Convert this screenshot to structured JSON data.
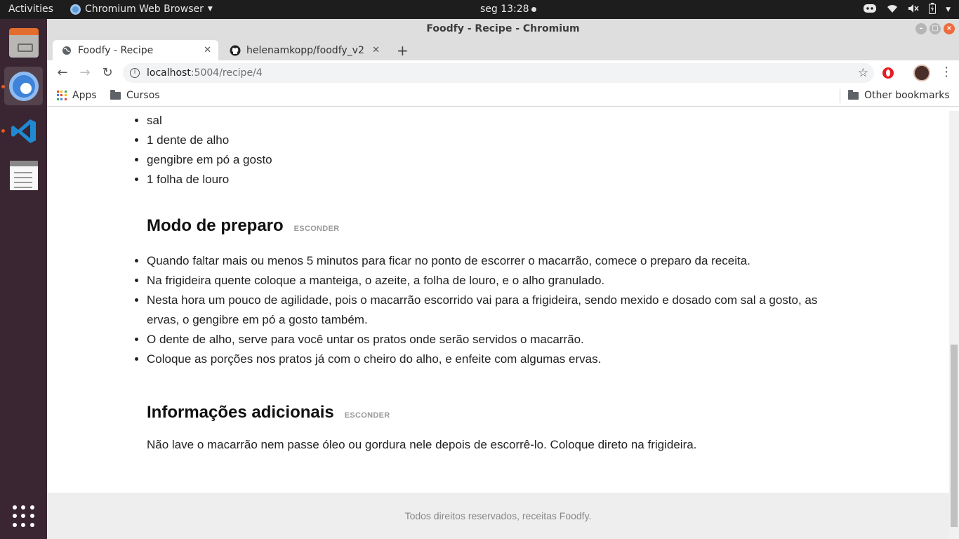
{
  "topbar": {
    "activities": "Activities",
    "app_name": "Chromium Web Browser",
    "clock": "seg 13:28"
  },
  "window": {
    "title": "Foodfy - Recipe - Chromium"
  },
  "tabs": [
    {
      "label": "Foodfy - Recipe"
    },
    {
      "label": "helenamkopp/foodfy_v2"
    }
  ],
  "omnibox": {
    "host": "localhost",
    "rest": ":5004/recipe/4"
  },
  "bookmarks": {
    "apps": "Apps",
    "cursos": "Cursos",
    "other": "Other bookmarks"
  },
  "page": {
    "ingredients": [
      "sal",
      "1 dente de alho",
      "gengibre em pó a gosto",
      "1 folha de louro"
    ],
    "preparation": {
      "title": "Modo de preparo",
      "toggle": "ESCONDER",
      "steps": [
        "Quando faltar mais ou menos 5 minutos para ficar no ponto de escorrer o macarrão, comece o preparo da receita.",
        "Na frigideira quente coloque a manteiga, o azeite, a folha de louro, e o alho granulado.",
        "Nesta hora um pouco de agilidade, pois o macarrão escorrido vai para a frigideira, sendo mexido e dosado com sal a gosto, as ervas, o gengibre em pó a gosto também.",
        "O dente de alho, serve para você untar os pratos onde serão servidos o macarrão.",
        "Coloque as porções nos pratos já com o cheiro do alho, e enfeite com algumas ervas."
      ]
    },
    "additional": {
      "title": "Informações adicionais",
      "toggle": "ESCONDER",
      "text": "Não lave o macarrão nem passe óleo ou gordura nele depois de escorrê-lo. Coloque direto na frigideira."
    },
    "footer": "Todos direitos reservados, receitas Foodfy."
  },
  "colors": {
    "ubuntu_orange": "#e95420",
    "dock_bg": "#3a2632",
    "topbar_bg": "#1d1d1d",
    "toggle_gray": "#999999"
  }
}
